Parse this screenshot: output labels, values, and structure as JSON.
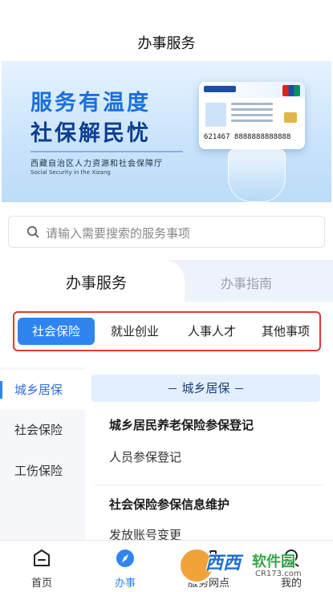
{
  "header": {
    "title": "办事服务"
  },
  "banner": {
    "slogan_line1": "服务有温度",
    "slogan_line2": "社保解民忧",
    "org": "西藏自治区人力资源和社会保障厅",
    "org_en": "Social Security in the Xizang",
    "card_number": "621467 8888888888888"
  },
  "search": {
    "placeholder": "请输入需要搜索的服务事项"
  },
  "tabs": [
    {
      "label": "办事服务",
      "active": true
    },
    {
      "label": "办事指南",
      "active": false
    }
  ],
  "categories": [
    {
      "label": "社会保险",
      "active": true
    },
    {
      "label": "就业创业",
      "active": false
    },
    {
      "label": "人事人才",
      "active": false
    },
    {
      "label": "其他事项",
      "active": false
    }
  ],
  "sidebar": {
    "items": [
      {
        "label": "城乡居保",
        "active": true
      },
      {
        "label": "社会保险",
        "active": false
      },
      {
        "label": "工伤保险",
        "active": false
      }
    ]
  },
  "content": {
    "section_title": "城乡居保",
    "groups": [
      {
        "title": "城乡居民养老保险参保登记",
        "items": [
          "人员参保登记"
        ]
      },
      {
        "title": "社会保险参保信息维护",
        "items": [
          "发放账号变更"
        ]
      }
    ]
  },
  "bottom_nav": [
    {
      "label": "首页",
      "icon": "home-icon",
      "active": false
    },
    {
      "label": "办事",
      "icon": "compass-icon",
      "active": true
    },
    {
      "label": "服务网点",
      "icon": "grid-icon",
      "active": false
    },
    {
      "label": "我的",
      "icon": "user-icon",
      "active": false
    }
  ],
  "watermark": {
    "brand": "西西",
    "brand2": "软件园",
    "url": "CR173.com"
  },
  "colors": {
    "accent": "#2f84f0",
    "highlight_border": "#e03a33"
  }
}
